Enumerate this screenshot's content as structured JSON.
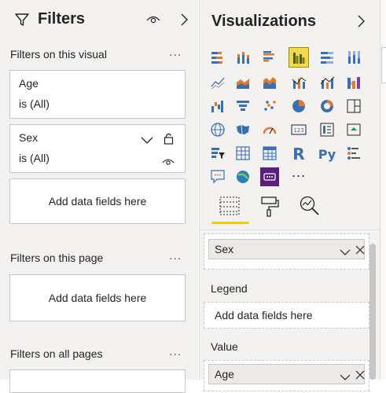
{
  "filters": {
    "title": "Filters",
    "sections": {
      "on_visual": "Filters on this visual",
      "on_page": "Filters on this page",
      "on_all_pages": "Filters on all pages"
    },
    "more": "...",
    "cards": [
      {
        "field": "Age",
        "state": "is (All)"
      },
      {
        "field": "Sex",
        "state": "is (All)"
      }
    ],
    "drop_placeholder": "Add data fields here"
  },
  "visualizations": {
    "title": "Visualizations",
    "more_visuals": "...",
    "icons": [
      "stacked-bar-chart-icon",
      "stacked-column-chart-icon",
      "clustered-bar-chart-icon",
      "clustered-column-chart-icon",
      "100-stacked-bar-chart-icon",
      "100-stacked-column-chart-icon",
      "line-chart-icon",
      "area-chart-icon",
      "stacked-area-chart-icon",
      "line-and-stacked-column-icon",
      "line-and-clustered-column-icon",
      "ribbon-chart-icon",
      "waterfall-chart-icon",
      "funnel-chart-icon",
      "scatter-chart-icon",
      "pie-chart-icon",
      "donut-chart-icon",
      "treemap-icon",
      "map-icon",
      "filled-map-icon",
      "gauge-icon",
      "card-icon",
      "multi-row-card-icon",
      "kpi-icon",
      "slicer-icon",
      "table-icon",
      "matrix-icon",
      "r-visual-icon",
      "python-visual-icon",
      "key-influencers-icon",
      "qa-icon",
      "arcgis-map-icon",
      "custom-visual-icon"
    ],
    "selected_icon": "clustered-column-chart-icon",
    "tabs": [
      "fields-tab",
      "format-tab",
      "analytics-tab"
    ],
    "wells": {
      "axis_field": "Sex",
      "legend_label": "Legend",
      "legend_placeholder": "Add data fields here",
      "value_label": "Value",
      "value_field": "Age"
    }
  },
  "colors": {
    "accent": "#f2c811",
    "pane_bg": "#f3f2f1",
    "border": "#c8c6c4"
  }
}
